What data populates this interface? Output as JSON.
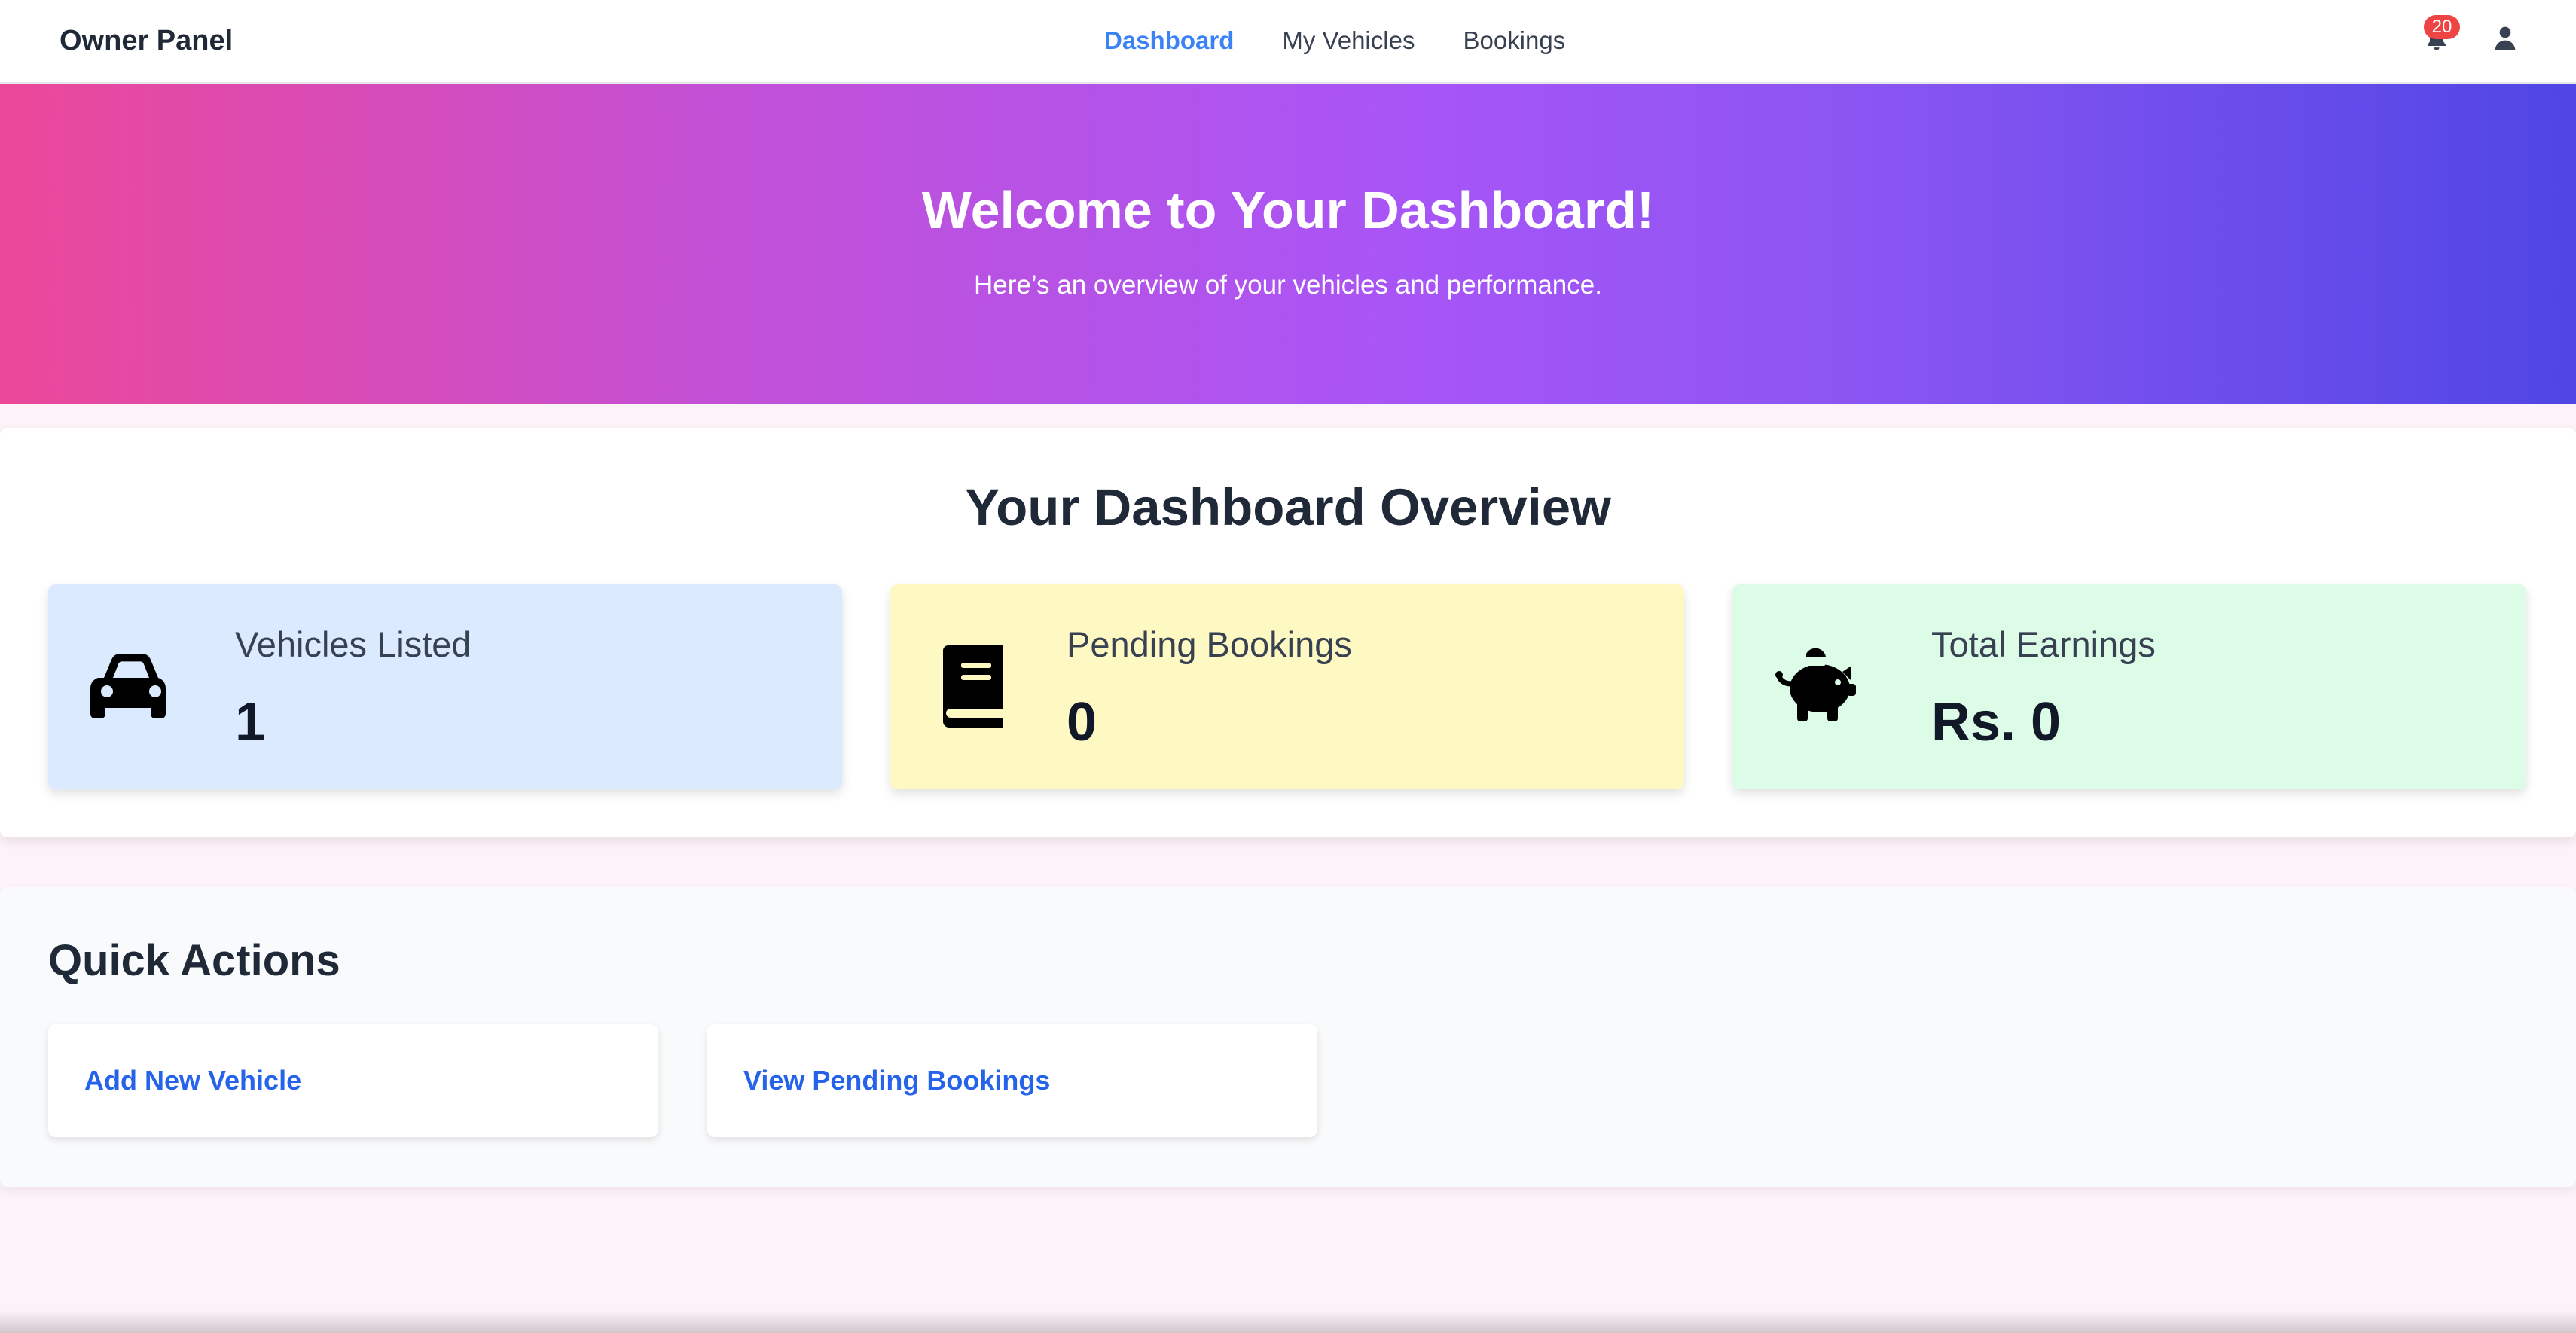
{
  "navbar": {
    "brand": "Owner Panel",
    "links": [
      "Dashboard",
      "My Vehicles",
      "Bookings"
    ],
    "active": "Dashboard",
    "notification_count": "20",
    "icons": {
      "notifications": "bell-icon",
      "profile": "user-icon"
    }
  },
  "hero": {
    "title": "Welcome to Your Dashboard!",
    "subtitle": "Here’s an overview of your vehicles and performance."
  },
  "overview": {
    "title": "Your Dashboard Overview",
    "cards": [
      {
        "label": "Vehicles Listed",
        "value": "1",
        "icon": "car-icon",
        "color": "#dbeafe"
      },
      {
        "label": "Pending Bookings",
        "value": "0",
        "icon": "book-icon",
        "color": "#fef9c3"
      },
      {
        "label": "Total Earnings",
        "value": "Rs. 0",
        "icon": "piggy-bank-icon",
        "color": "#dcfce7"
      }
    ]
  },
  "quick_actions": {
    "title": "Quick Actions",
    "actions": [
      {
        "label": "Add New Vehicle"
      },
      {
        "label": "View Pending Bookings"
      }
    ]
  },
  "colors": {
    "accent": "#3b82f6",
    "link": "#2563eb",
    "badge": "#ef4444",
    "hero_gradient_start": "#ec4899",
    "hero_gradient_end": "#4f46e5"
  }
}
